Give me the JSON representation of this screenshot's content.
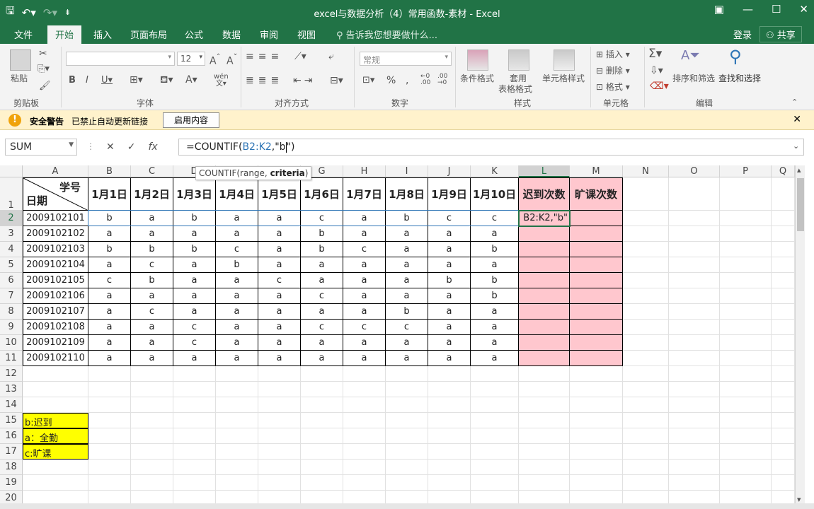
{
  "window": {
    "title": "excel与数据分析（4）常用函数-素材 - Excel"
  },
  "tabs": [
    "文件",
    "开始",
    "插入",
    "页面布局",
    "公式",
    "数据",
    "审阅",
    "视图"
  ],
  "active_tab": "开始",
  "tellme": "告诉我您想要做什么...",
  "login": "登录",
  "share": "共享",
  "ribbon": {
    "paste": "粘贴",
    "clipboard": "剪贴板",
    "font_group": "字体",
    "font_size": "12",
    "align_group": "对齐方式",
    "number_group": "数字",
    "number_format": "常规",
    "styles_group": "样式",
    "cond_format": "条件格式",
    "table_format": "套用",
    "table_format2": "表格格式",
    "cell_style": "单元格样式",
    "cells_group": "单元格",
    "insert": "插入",
    "delete": "删除",
    "format": "格式",
    "edit_group": "编辑",
    "sort_filter": "排序和筛选",
    "find_select": "查找和选择",
    "wen": "wén"
  },
  "warning": {
    "bold": "安全警告",
    "text": "已禁止自动更新链接",
    "button": "启用内容"
  },
  "namebox": "SUM",
  "formula": {
    "prefix": "=COUNTIF(",
    "ref": "B2:K2",
    "suffix": ",\"b",
    "end": "\")"
  },
  "tooltip": {
    "fn": "COUNTIF(range, ",
    "arg": "criteria",
    "close": ")"
  },
  "columns": [
    "A",
    "B",
    "C",
    "D",
    "E",
    "F",
    "G",
    "H",
    "I",
    "J",
    "K",
    "L",
    "M",
    "N",
    "O",
    "P",
    "Q"
  ],
  "header": {
    "top": "学号",
    "bottom": "日期",
    "dates": [
      "1月1日",
      "1月2日",
      "1月3日",
      "1月4日",
      "1月5日",
      "1月6日",
      "1月7日",
      "1月8日",
      "1月9日",
      "1月10日"
    ],
    "late": "迟到次数",
    "absent": "旷课次数"
  },
  "rows": [
    {
      "id": "2009102101",
      "v": [
        "b",
        "a",
        "b",
        "a",
        "a",
        "c",
        "a",
        "b",
        "c",
        "c"
      ]
    },
    {
      "id": "2009102102",
      "v": [
        "a",
        "a",
        "a",
        "a",
        "a",
        "b",
        "a",
        "a",
        "a",
        "a"
      ]
    },
    {
      "id": "2009102103",
      "v": [
        "b",
        "b",
        "b",
        "c",
        "a",
        "b",
        "c",
        "a",
        "a",
        "b"
      ]
    },
    {
      "id": "2009102104",
      "v": [
        "a",
        "c",
        "a",
        "b",
        "a",
        "a",
        "a",
        "a",
        "a",
        "a"
      ]
    },
    {
      "id": "2009102105",
      "v": [
        "c",
        "b",
        "a",
        "a",
        "c",
        "a",
        "a",
        "a",
        "b",
        "b"
      ]
    },
    {
      "id": "2009102106",
      "v": [
        "a",
        "a",
        "a",
        "a",
        "a",
        "c",
        "a",
        "a",
        "a",
        "b"
      ]
    },
    {
      "id": "2009102107",
      "v": [
        "a",
        "c",
        "a",
        "a",
        "a",
        "a",
        "a",
        "b",
        "a",
        "a"
      ]
    },
    {
      "id": "2009102108",
      "v": [
        "a",
        "a",
        "c",
        "a",
        "a",
        "c",
        "c",
        "c",
        "a",
        "a"
      ]
    },
    {
      "id": "2009102109",
      "v": [
        "a",
        "a",
        "c",
        "a",
        "a",
        "a",
        "a",
        "a",
        "a",
        "a"
      ]
    },
    {
      "id": "2009102110",
      "v": [
        "a",
        "a",
        "a",
        "a",
        "a",
        "a",
        "a",
        "a",
        "a",
        "a"
      ]
    }
  ],
  "editing_cell_text": "B2:K2,\"b\"",
  "legend": [
    "b:迟到",
    "a：全勤",
    "c:旷课"
  ],
  "row_numbers": [
    "1",
    "2",
    "3",
    "4",
    "5",
    "6",
    "7",
    "8",
    "9",
    "10",
    "11",
    "12",
    "13",
    "14",
    "15",
    "16",
    "17",
    "18",
    "19",
    "20"
  ]
}
